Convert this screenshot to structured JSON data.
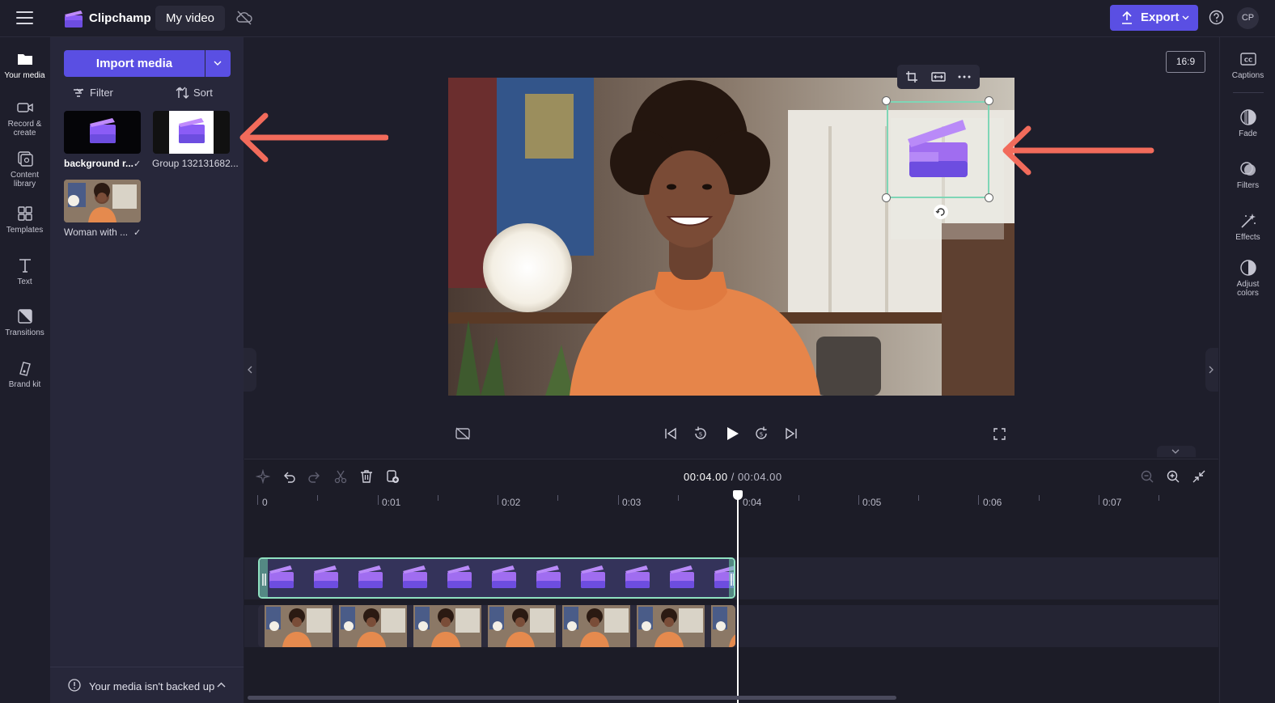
{
  "topbar": {
    "app_name": "Clipchamp",
    "project_name": "My video",
    "export_label": "Export",
    "avatar_initials": "CP",
    "accent_color": "#5a4fe3"
  },
  "leftnav": {
    "items": [
      {
        "label": "Your media",
        "icon": "folder-icon"
      },
      {
        "label": "Record & create",
        "icon": "camera-icon"
      },
      {
        "label": "Content library",
        "icon": "library-icon"
      },
      {
        "label": "Templates",
        "icon": "templates-icon"
      },
      {
        "label": "Text",
        "icon": "text-icon"
      },
      {
        "label": "Transitions",
        "icon": "transitions-icon"
      },
      {
        "label": "Brand kit",
        "icon": "brand-kit-icon"
      }
    ]
  },
  "media": {
    "import_label": "Import media",
    "filter_label": "Filter",
    "sort_label": "Sort",
    "items": [
      {
        "label": "background r...",
        "check": "✓"
      },
      {
        "label": "Group 132131682..."
      },
      {
        "label": "Woman with ...",
        "check": "✓"
      }
    ],
    "backup_text": "Your media isn't backed up"
  },
  "preview": {
    "aspect_ratio": "16:9"
  },
  "rightpanel": {
    "items": [
      {
        "label": "Captions",
        "icon": "captions-icon"
      },
      {
        "label": "Fade",
        "icon": "fade-icon"
      },
      {
        "label": "Filters",
        "icon": "filters-icon"
      },
      {
        "label": "Effects",
        "icon": "effects-icon"
      },
      {
        "label": "Adjust colors",
        "icon": "adjust-colors-icon"
      }
    ]
  },
  "timeline": {
    "current_time": "00:04.00",
    "separator": " / ",
    "total_time": "00:04.00",
    "ruler_labels": [
      "0",
      "0:01",
      "0:02",
      "0:03",
      "0:04",
      "0:05",
      "0:06",
      "0:07"
    ]
  },
  "annotations": {
    "arrow_color": "#f26b5b"
  }
}
